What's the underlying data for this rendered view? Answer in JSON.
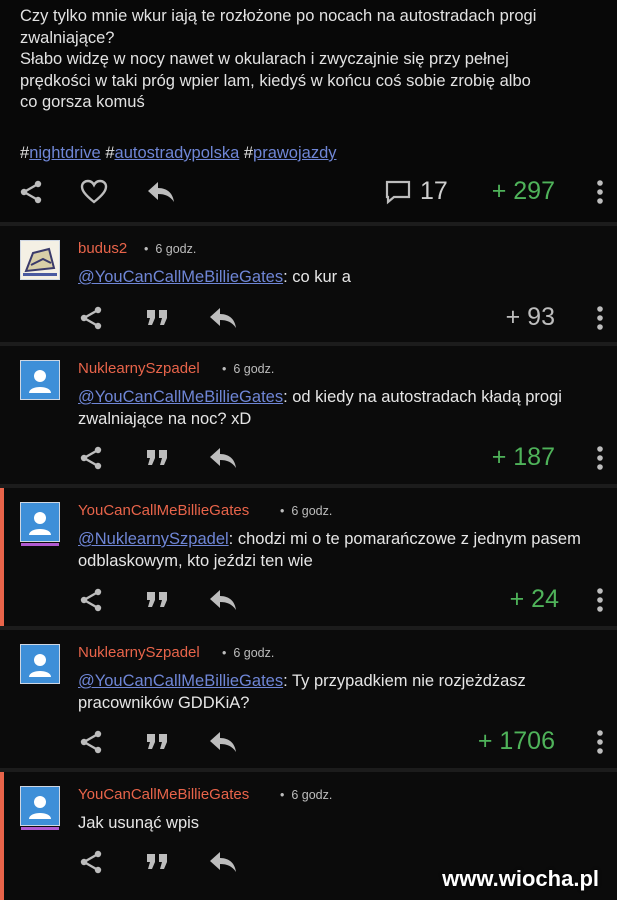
{
  "post": {
    "lines": [
      "Czy tylko mnie wkur  iają te rozłożone po nocach na autostradach progi",
      "zwalniające?",
      "Słabo widzę w nocy nawet w okularach i zwyczajnie się przy pełnej",
      "prędkości w taki próg wpier    lam, kiedyś w końcu coś sobie zrobię albo",
      "co gorsza komuś"
    ],
    "tags": [
      "nightdrive",
      "autostradypolska",
      "prawojazdy"
    ],
    "comments_count": "17",
    "votes": "+ 297"
  },
  "comments": [
    {
      "author": "budus2",
      "time": "6 godz.",
      "mention": "@YouCanCallMeBillieGates",
      "text": ": co kur   a",
      "votes": "+ 93"
    },
    {
      "author": "NuklearnySzpadel",
      "time": "6 godz.",
      "mention": "@YouCanCallMeBillieGates",
      "text": ": od kiedy na autostradach kładą progi zwalniające na noc? xD",
      "votes": "+ 187"
    },
    {
      "author": "YouCanCallMeBillieGates",
      "time": "6 godz.",
      "mention": "@NuklearnySzpadel",
      "text": ": chodzi mi o te pomarańczowe z jednym pasem odblaskowym, kto jeździ ten wie",
      "votes": "+ 24"
    },
    {
      "author": "NuklearnySzpadel",
      "time": "6 godz.",
      "mention": "@YouCanCallMeBillieGates",
      "text": ": Ty przypadkiem nie rozjeżdżasz pracowników GDDKiA?",
      "votes": "+ 1706"
    },
    {
      "author": "YouCanCallMeBillieGates",
      "time": "6 godz.",
      "mention": "",
      "text": "Jak usunąć wpis",
      "votes": ""
    }
  ],
  "watermark": "www.wiocha.pl"
}
